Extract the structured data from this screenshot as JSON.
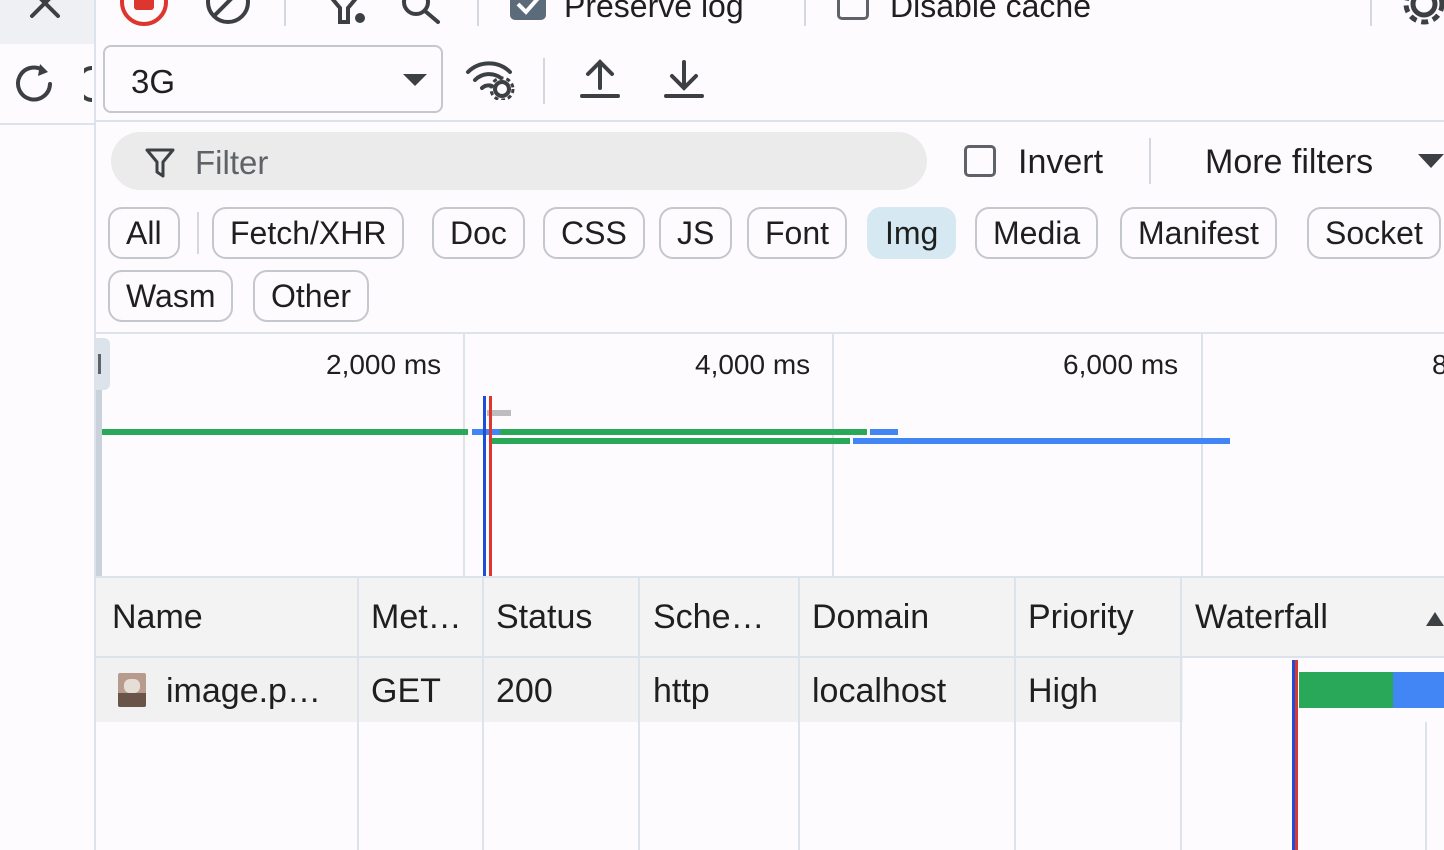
{
  "toolbar": {
    "preserve_log_label": "Preserve log",
    "preserve_log_checked": true,
    "disable_cache_label": "Disable cache",
    "disable_cache_checked": false
  },
  "throttling": {
    "selected": "3G"
  },
  "filter": {
    "placeholder": "Filter",
    "invert_label": "Invert",
    "more_filters_label": "More filters"
  },
  "type_filters": {
    "chips": [
      "All",
      "Fetch/XHR",
      "Doc",
      "CSS",
      "JS",
      "Font",
      "Img",
      "Media",
      "Manifest",
      "Socket",
      "Wasm",
      "Other"
    ],
    "active": "Img"
  },
  "overview": {
    "ticks": [
      "2,000 ms",
      "4,000 ms",
      "6,000 ms",
      "8"
    ]
  },
  "table": {
    "columns": [
      "Name",
      "Met…",
      "Status",
      "Sche…",
      "Domain",
      "Priority",
      "Waterfall"
    ],
    "rows": [
      {
        "name": "image.p…",
        "method": "GET",
        "status": "200",
        "scheme": "http",
        "domain": "localhost",
        "priority": "High"
      }
    ]
  },
  "colors": {
    "accent_blue": "#4285f4",
    "accent_green": "#2aa85a",
    "record_red": "#dc362e",
    "active_chip": "#d6e8f2"
  },
  "icons": [
    "close-icon",
    "record-stop-icon",
    "clear-icon",
    "fetch-filter-icon",
    "search-icon",
    "reload-icon",
    "network-conditions-icon",
    "import-har-icon",
    "export-har-icon",
    "filter-funnel-icon",
    "settings-gear-icon",
    "image-file-icon"
  ]
}
